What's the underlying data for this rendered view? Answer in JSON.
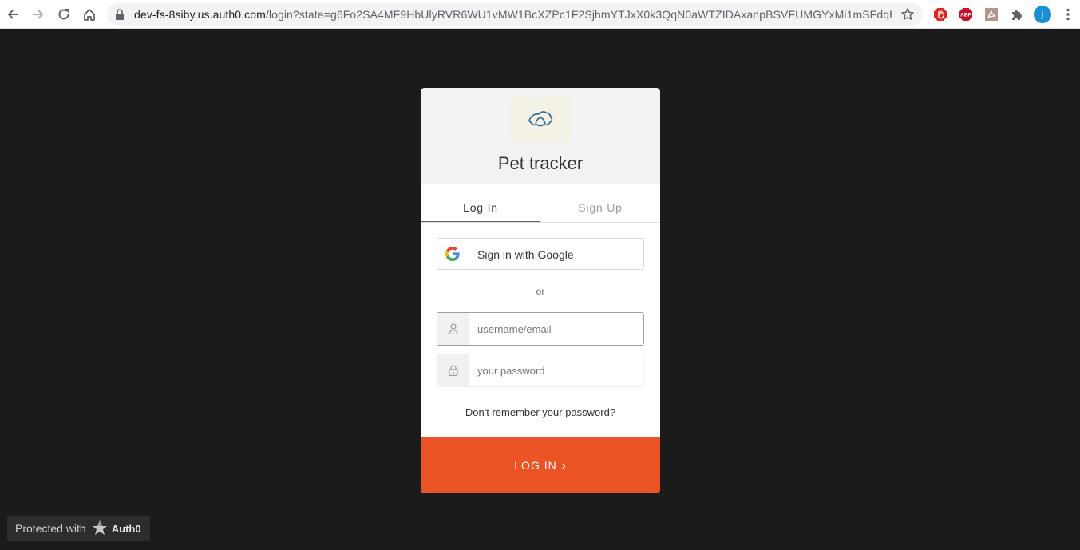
{
  "browser": {
    "url_host": "dev-fs-8siby.us.auth0.com",
    "url_path": "/login?state=g6Fo2SA4MF9HbUlyRVR6WU1vMW1BcXZPc1F2SjhmYTJxX0k3QqN0aWTZIDAxanpBSVFUMGYxMi1mSFdqR21lS...",
    "extensions": [
      "adblock-icon",
      "abp-icon",
      "pdf-icon",
      "puzzle-icon"
    ],
    "profile_initial": "j"
  },
  "card": {
    "app_title": "Pet tracker",
    "tabs": [
      {
        "label": "Log In",
        "active": true
      },
      {
        "label": "Sign Up",
        "active": false
      }
    ],
    "google_button_label": "Sign in with Google",
    "or_label": "or",
    "username_placeholder": "username/email",
    "password_placeholder": "your password",
    "forgot_label": "Don't remember your password?",
    "submit_label": "LOG IN",
    "submit_chevron": "›"
  },
  "badge": {
    "prefix": "Protected with",
    "brand": "Auth0"
  },
  "colors": {
    "accent": "#ea5323",
    "background": "#1b1b1b"
  }
}
